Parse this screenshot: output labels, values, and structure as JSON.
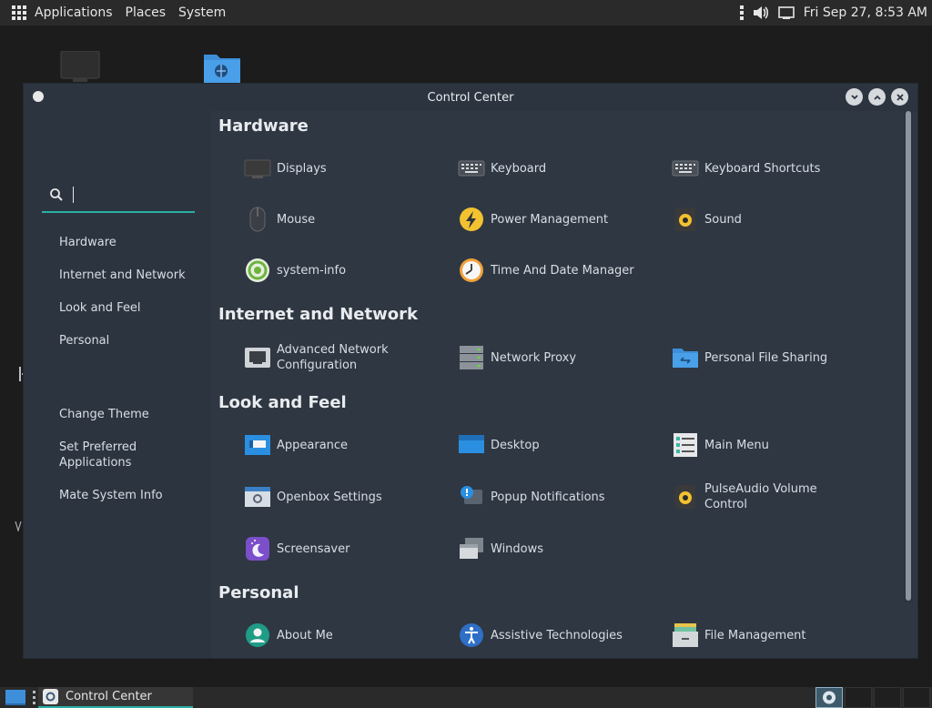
{
  "top_panel": {
    "menu": [
      "Applications",
      "Places",
      "System"
    ],
    "clock": "Fri Sep 27,  8:53 AM",
    "tray_icons": [
      "menu-dots-icon",
      "volume-icon",
      "network-wired-icon"
    ]
  },
  "window": {
    "title": "Control Center",
    "buttons": [
      "minimize",
      "maximize",
      "close"
    ]
  },
  "sidebar": {
    "search_value": "",
    "sections": [
      "Hardware",
      "Internet and Network",
      "Look and Feel",
      "Personal"
    ],
    "common_tasks": [
      "Change Theme",
      "Set Preferred Applications",
      "Mate System Info"
    ]
  },
  "content": {
    "sections": [
      {
        "title": "Hardware",
        "items": [
          "Displays",
          "Keyboard",
          "Keyboard Shortcuts",
          "Mouse",
          "Power Management",
          "Sound",
          "system-info",
          "Time And Date Manager"
        ]
      },
      {
        "title": "Internet and Network",
        "items": [
          "Advanced Network Configuration",
          "Network Proxy",
          "Personal File Sharing"
        ]
      },
      {
        "title": "Look and Feel",
        "items": [
          "Appearance",
          "Desktop",
          "Main Menu",
          "Openbox Settings",
          "Popup Notifications",
          "PulseAudio Volume Control",
          "Screensaver",
          "Windows"
        ]
      },
      {
        "title": "Personal",
        "items": [
          "About Me",
          "Assistive Technologies",
          "File Management"
        ]
      }
    ]
  },
  "bottom_panel": {
    "task_label": "Control Center"
  },
  "colors": {
    "accent": "#2bb0a6",
    "window_bg": "#2c3440",
    "content_bg": "#2f3743",
    "panel_bg": "#2a2a2a"
  }
}
